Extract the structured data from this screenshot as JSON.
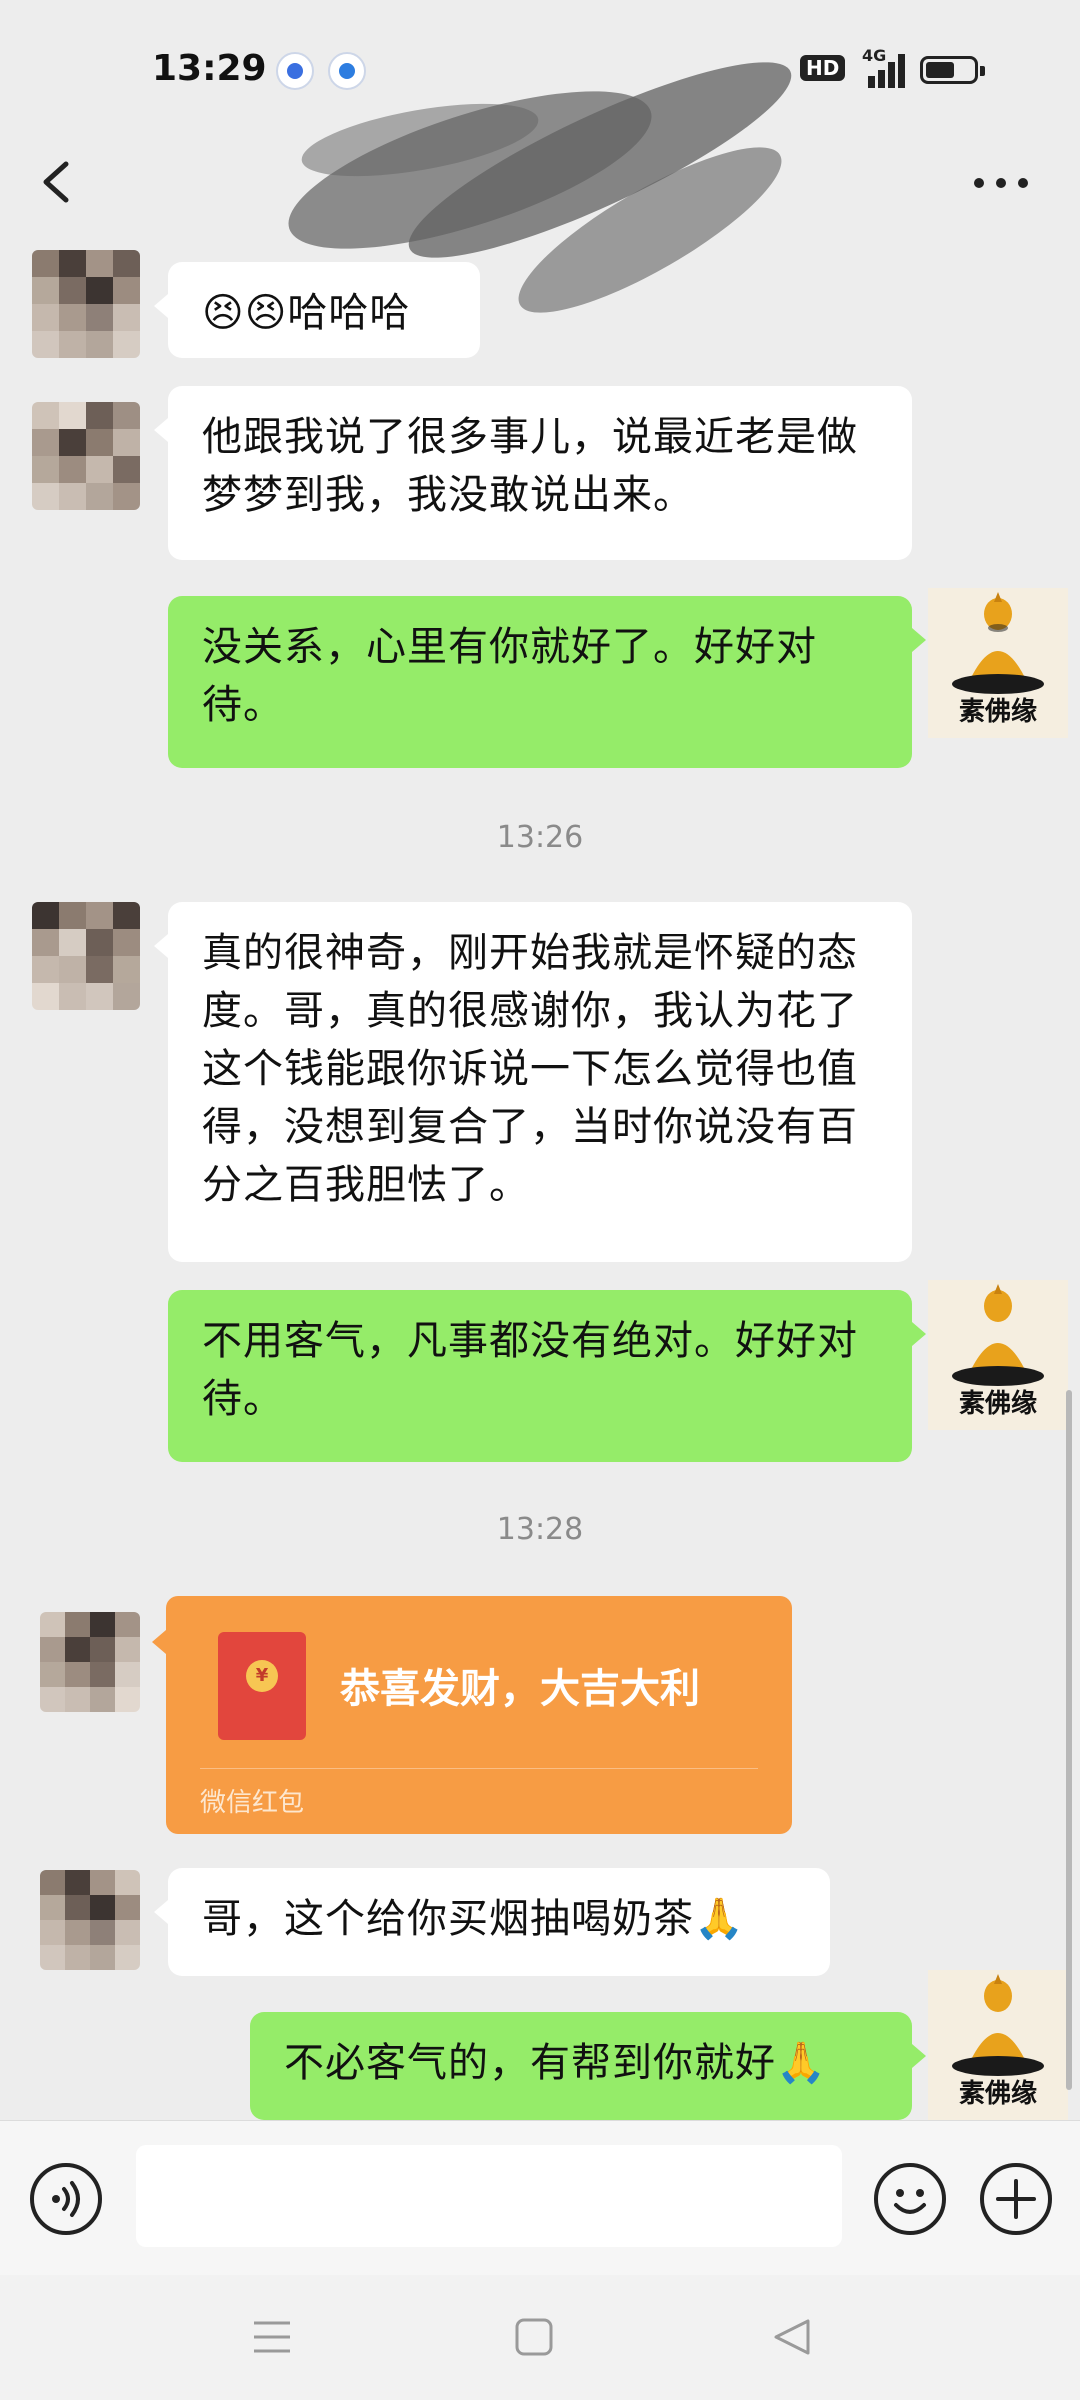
{
  "status_bar": {
    "time": "13:29",
    "hd_label": "HD",
    "network_label": "4G",
    "battery_level": 0.6
  },
  "header": {
    "back_icon": "back-arrow-icon",
    "more_icon": "more-icon"
  },
  "messages": [
    {
      "type": "text",
      "direction": "in",
      "text": "😣😣哈哈哈"
    },
    {
      "type": "text",
      "direction": "in",
      "text": "他跟我说了很多事儿，说最近老是做梦梦到我，我没敢说出来。"
    },
    {
      "type": "text",
      "direction": "out",
      "text": "没关系，心里有你就好了。好好对待。"
    },
    {
      "type": "time",
      "text": "13:26"
    },
    {
      "type": "text",
      "direction": "in",
      "text": "真的很神奇，刚开始我就是怀疑的态度。哥，真的很感谢你，我认为花了这个钱能跟你诉说一下怎么觉得也值得，没想到复合了，当时你说没有百分之百我胆怯了。"
    },
    {
      "type": "text",
      "direction": "out",
      "text": "不用客气，凡事都没有绝对。好好对待。"
    },
    {
      "type": "time",
      "text": "13:28"
    },
    {
      "type": "red_packet",
      "direction": "in",
      "title": "恭喜发财，大吉大利",
      "label": "微信红包",
      "coin_symbol": "¥"
    },
    {
      "type": "text",
      "direction": "in",
      "text": "哥，这个给你买烟抽喝奶茶🙏"
    },
    {
      "type": "text",
      "direction": "out",
      "text": "不必客气的，有帮到你就好🙏"
    }
  ],
  "self_avatar_label": "素佛缘",
  "input_bar": {
    "voice_icon": "voice-icon",
    "emoji_icon": "emoji-icon",
    "plus_icon": "plus-icon"
  },
  "system_nav": {
    "menu_icon": "menu-icon",
    "home_icon": "home-icon",
    "back_icon": "back-triangle-icon"
  },
  "colors": {
    "outgoing_bubble": "#95ec69",
    "incoming_bubble": "#ffffff",
    "red_packet": "#f79c44",
    "background": "#ededed"
  }
}
